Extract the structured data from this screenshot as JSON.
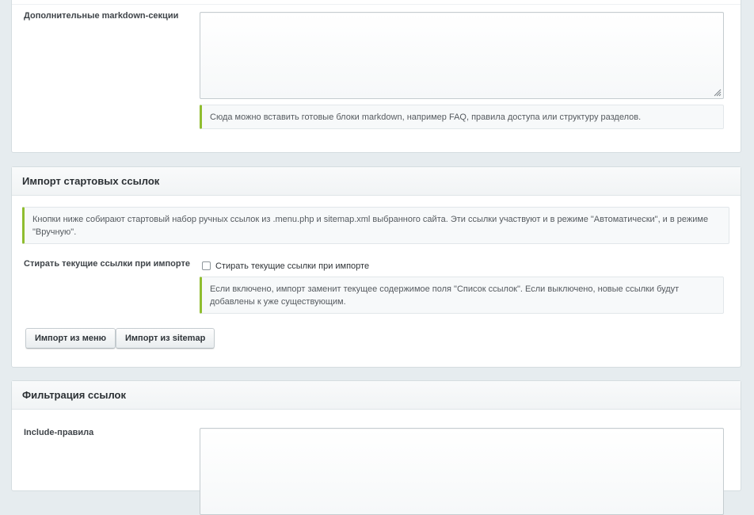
{
  "markdown_section": {
    "label": "Дополнительные markdown-секции",
    "textarea_value": "",
    "hint": "Сюда можно вставить готовые блоки markdown, например FAQ, правила доступа или структуру разделов."
  },
  "import_section": {
    "title": "Импорт стартовых ссылок",
    "info": "Кнопки ниже собирают стартовый набор ручных ссылок из .menu.php и sitemap.xml выбранного сайта. Эти ссылки участвуют и в режиме \"Автоматически\", и в режиме \"Вручную\".",
    "erase_label": "Стирать текущие ссылки при импорте",
    "erase_checkbox_label": "Стирать текущие ссылки при импорте",
    "erase_checked": false,
    "erase_hint": "Если включено, импорт заменит текущее содержимое поля \"Список ссылок\". Если выключено, новые ссылки будут добавлены к уже существующим.",
    "btn_menu": "Импорт из меню",
    "btn_sitemap": "Импорт из sitemap"
  },
  "filter_section": {
    "title": "Фильтрация ссылок",
    "include_label": "Include-правила",
    "include_value": ""
  },
  "colors": {
    "accent": "#8fbd2f",
    "background": "#e6ecef",
    "panel": "#ffffff"
  }
}
